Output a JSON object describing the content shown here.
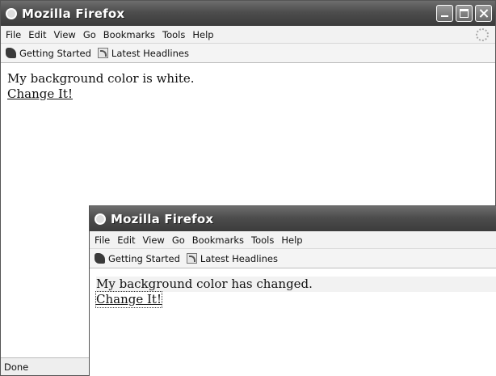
{
  "window1": {
    "title": "Mozilla Firefox",
    "menu": [
      "File",
      "Edit",
      "View",
      "Go",
      "Bookmarks",
      "Tools",
      "Help"
    ],
    "bookmarks": [
      "Getting Started",
      "Latest Headlines"
    ],
    "content": {
      "message": "My background color is white.",
      "link": "Change It!"
    },
    "status": "Done"
  },
  "window2": {
    "title": "Mozilla Firefox",
    "menu": [
      "File",
      "Edit",
      "View",
      "Go",
      "Bookmarks",
      "Tools",
      "Help"
    ],
    "bookmarks": [
      "Getting Started",
      "Latest Headlines"
    ],
    "content": {
      "message": "My background color has changed.",
      "link": "Change It!"
    }
  },
  "icons": {
    "app": "firefox-icon",
    "bookmark1": "getting-started-icon",
    "bookmark2": "rss-feed-icon",
    "throbber": "throbber-icon"
  }
}
